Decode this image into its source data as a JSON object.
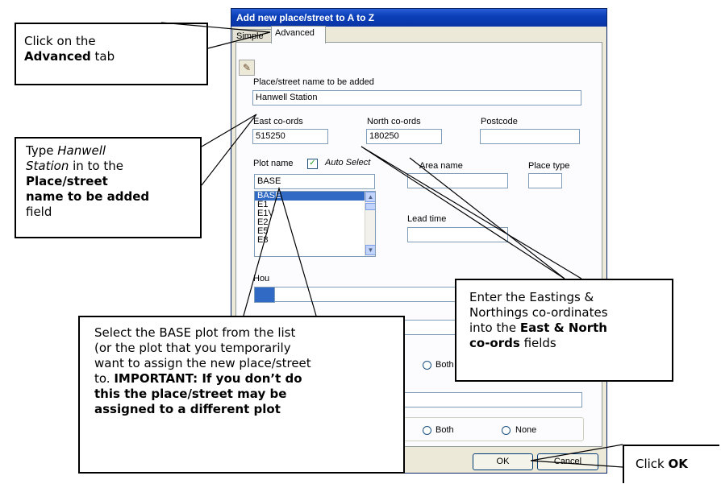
{
  "dialog": {
    "title": "Add new place/street to A to Z",
    "tabs": [
      "Simple",
      "Advanced"
    ],
    "labels": {
      "place_name": "Place/street name to be added",
      "east": "East co-ords",
      "north": "North co-ords",
      "postcode": "Postcode",
      "plot_name": "Plot name",
      "auto_select": "Auto Select",
      "area_name": "Area name",
      "place_type": "Place type",
      "lead_time": "Lead time",
      "house": "Hou"
    },
    "values": {
      "place_name": "Hanwell Station",
      "east": "515250",
      "north": "180250",
      "postcode": "",
      "plot_name": "BASE",
      "area_name": "",
      "place_type": ""
    },
    "plot_list": [
      "BASE",
      "E1",
      "E1V",
      "E2",
      "E5",
      "E8"
    ],
    "auto_select_checked": "✓",
    "radio_labels": {
      "both_1": "Both",
      "both_2": "Both",
      "none": "None"
    },
    "buttons": {
      "ok": "OK",
      "cancel": "Cancel"
    }
  },
  "callouts": {
    "advanced": {
      "l1": "Click on the",
      "l2b": "Advanced",
      "l2": " tab"
    },
    "type": {
      "l1": "Type ",
      "l1i": "Hanwell",
      "l2i": "Station",
      "l2": " in to the",
      "l3b": "Place/street",
      "l4b": "name to be added",
      "l5": "field"
    },
    "base": {
      "t1": "Select the BASE plot from the list",
      "t2": "(or the plot that you temporarily",
      "t3": "want to assign the new place/street",
      "t4": "to. ",
      "t4b": "IMPORTANT: If you don’t do",
      "t5b": "this the place/street may be",
      "t6b": "assigned to a different plot"
    },
    "coords": {
      "l1": "Enter the Eastings &",
      "l2": "Northings co-ordinates",
      "l3": "into the ",
      "l3b": "East & North",
      "l4b": "co-ords",
      "l4": " fields"
    },
    "ok": {
      "t": "Click ",
      "tb": "OK"
    }
  }
}
